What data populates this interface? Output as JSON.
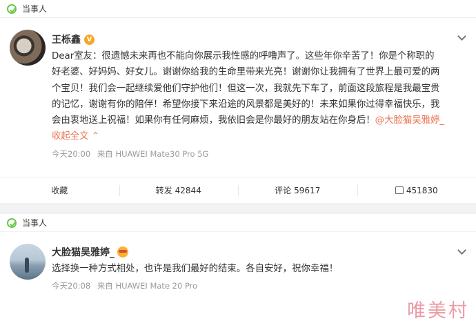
{
  "posts": [
    {
      "tag": "当事人",
      "author": "王栎鑫",
      "lines": [
        "Dear室友：很遗憾未来再也不能向你展示我性感的呼噜声了。这些年你辛苦了！你是个称职的",
        "好老婆、好妈妈、好女儿。谢谢你给我的生命里带来光亮！谢谢你让我拥有了世界上最可爱的两",
        "个宝贝！我们会一起继续爱他们守护他们！但这一次，我就先下车了，前面这段旅程是我最宝贵",
        "的记忆，谢谢有你的陪伴！希望你接下来沿途的风景都是美好的！未来如果你过得幸福快乐，我",
        "会由衷地送上祝福！如果你有任何麻烦，我依旧会是你最好的朋友站在你身后！"
      ],
      "mention": "@大脸猫吴雅婷_",
      "collapse": "收起全文",
      "collapse_arrow": "⌃",
      "time": "今天20:00",
      "source": "来自 HUAWEI Mate30 Pro 5G",
      "actions": {
        "collect_label": "收藏",
        "repost_label": "转发",
        "repost_count": "42844",
        "comment_label": "评论",
        "comment_count": "59617",
        "like_count": "451830"
      }
    },
    {
      "tag": "当事人",
      "author": "大脸猫吴雅婷_",
      "text": "选择换一种方式相处，也许是我们最好的结束。各自安好，祝你幸福！",
      "time": "今天20:08",
      "source": "来自 HUAWEI Mate 20 Pro"
    }
  ],
  "watermark": "唯美村",
  "colors": {
    "accent": "#eb7350",
    "tag_green": "#6bc84a",
    "verified": "#f6a623"
  }
}
